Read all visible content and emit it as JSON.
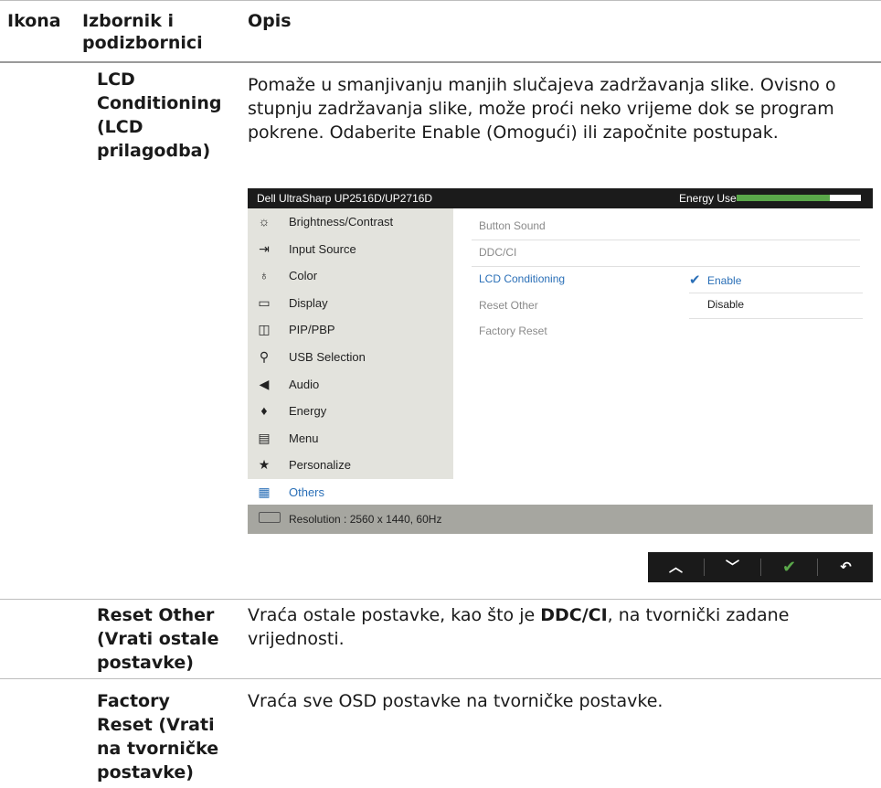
{
  "table": {
    "headers": {
      "icon": "Ikona",
      "menu": "Izbornik i\npodizbornici",
      "desc": "Opis"
    },
    "rows": [
      {
        "menu": "LCD\nConditioning\n(LCD\nprilagodba)",
        "desc": "Pomaže u smanjivanju manjih slučajeva zadržavanja slike. Ovisno o stupnju zadržavanja slike, može proći neko vrijeme dok se program pokrene. Odaberite Enable (Omogući) ili započnite postupak."
      },
      {
        "menu": "Reset Other\n(Vrati ostale\npostavke)",
        "desc_before": "Vraća ostale postavke, kao što je ",
        "desc_bold": "DDC/CI",
        "desc_after": ", na tvornički zadane vrijednosti."
      },
      {
        "menu": "Factory\nReset (Vrati\nna tvorničke\npostavke)",
        "desc": "Vraća sve OSD postavke na tvorničke postavke."
      }
    ]
  },
  "osd": {
    "model": "Dell UltraSharp UP2516D/UP2716D",
    "energy_label": "Energy Use",
    "energy_level": 0.75,
    "colors": {
      "energy": "#5aa84a",
      "accent": "#2a6fb7"
    },
    "menu": [
      {
        "label": "Brightness/Contrast",
        "icon": "sun-icon",
        "glyph": "☼"
      },
      {
        "label": "Input Source",
        "icon": "input-source-icon",
        "glyph": "⇥"
      },
      {
        "label": "Color",
        "icon": "color-icon",
        "glyph": "♁"
      },
      {
        "label": "Display",
        "icon": "monitor-icon",
        "glyph": "▭"
      },
      {
        "label": "PIP/PBP",
        "icon": "pip-icon",
        "glyph": "◫"
      },
      {
        "label": "USB Selection",
        "icon": "usb-icon",
        "glyph": "⚲"
      },
      {
        "label": "Audio",
        "icon": "speaker-icon",
        "glyph": "◀"
      },
      {
        "label": "Energy",
        "icon": "leaf-icon",
        "glyph": "♦"
      },
      {
        "label": "Menu",
        "icon": "menu-icon",
        "glyph": "▤"
      },
      {
        "label": "Personalize",
        "icon": "star-icon",
        "glyph": "★"
      }
    ],
    "selected_menu": {
      "label": "Others",
      "icon": "others-icon",
      "glyph": "▦"
    },
    "submenu": [
      "Button Sound",
      "DDC/CI",
      "LCD Conditioning",
      "Reset Other",
      "Factory Reset"
    ],
    "options": [
      "Enable",
      "Disable"
    ],
    "selected_option": "Enable",
    "resolution": "Resolution : 2560 x 1440, 60Hz",
    "buttons": [
      {
        "name": "up",
        "icon": "chevron-up-icon",
        "glyph": "︿"
      },
      {
        "name": "down",
        "icon": "chevron-down-icon",
        "glyph": "﹀"
      },
      {
        "name": "ok",
        "icon": "check-icon",
        "glyph": "✔"
      },
      {
        "name": "back",
        "icon": "back-icon",
        "glyph": "↶"
      }
    ]
  }
}
